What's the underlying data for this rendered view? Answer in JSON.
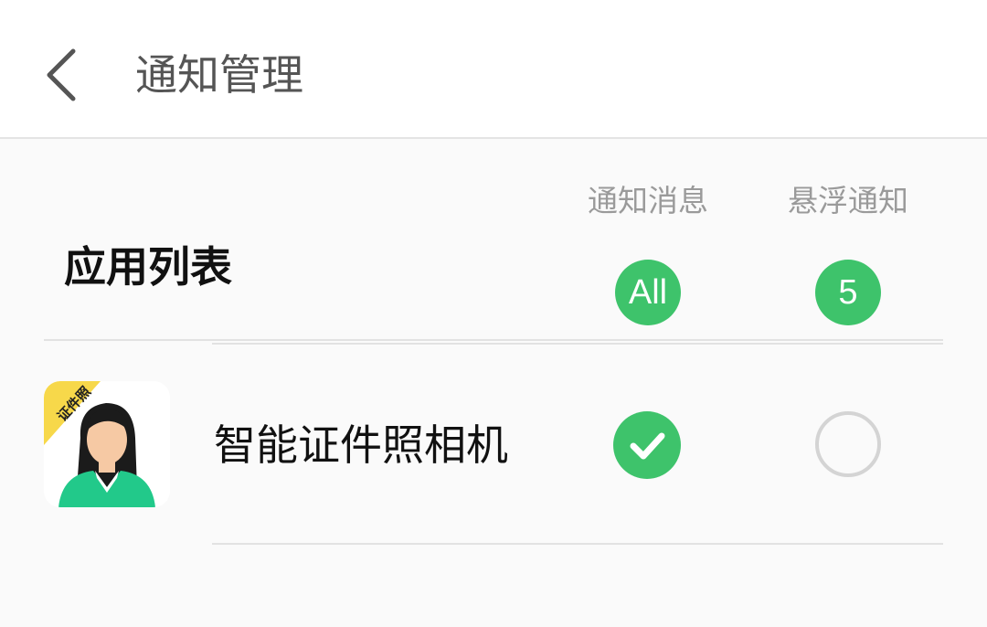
{
  "header": {
    "title": "通知管理",
    "back_icon": "chevron-left-icon"
  },
  "list_header": {
    "section_title": "应用列表",
    "col_notify_label": "通知消息",
    "col_float_label": "悬浮通知",
    "notify_all_label": "All",
    "float_count": "5"
  },
  "apps": [
    {
      "name": "智能证件照相机",
      "icon_badge": "证件照",
      "notify_enabled": true,
      "float_enabled": false
    }
  ],
  "colors": {
    "accent": "#3ec36b",
    "badge": "#f7d84a",
    "icon_shirt": "#22c98a",
    "divider": "#e2e2e2"
  }
}
